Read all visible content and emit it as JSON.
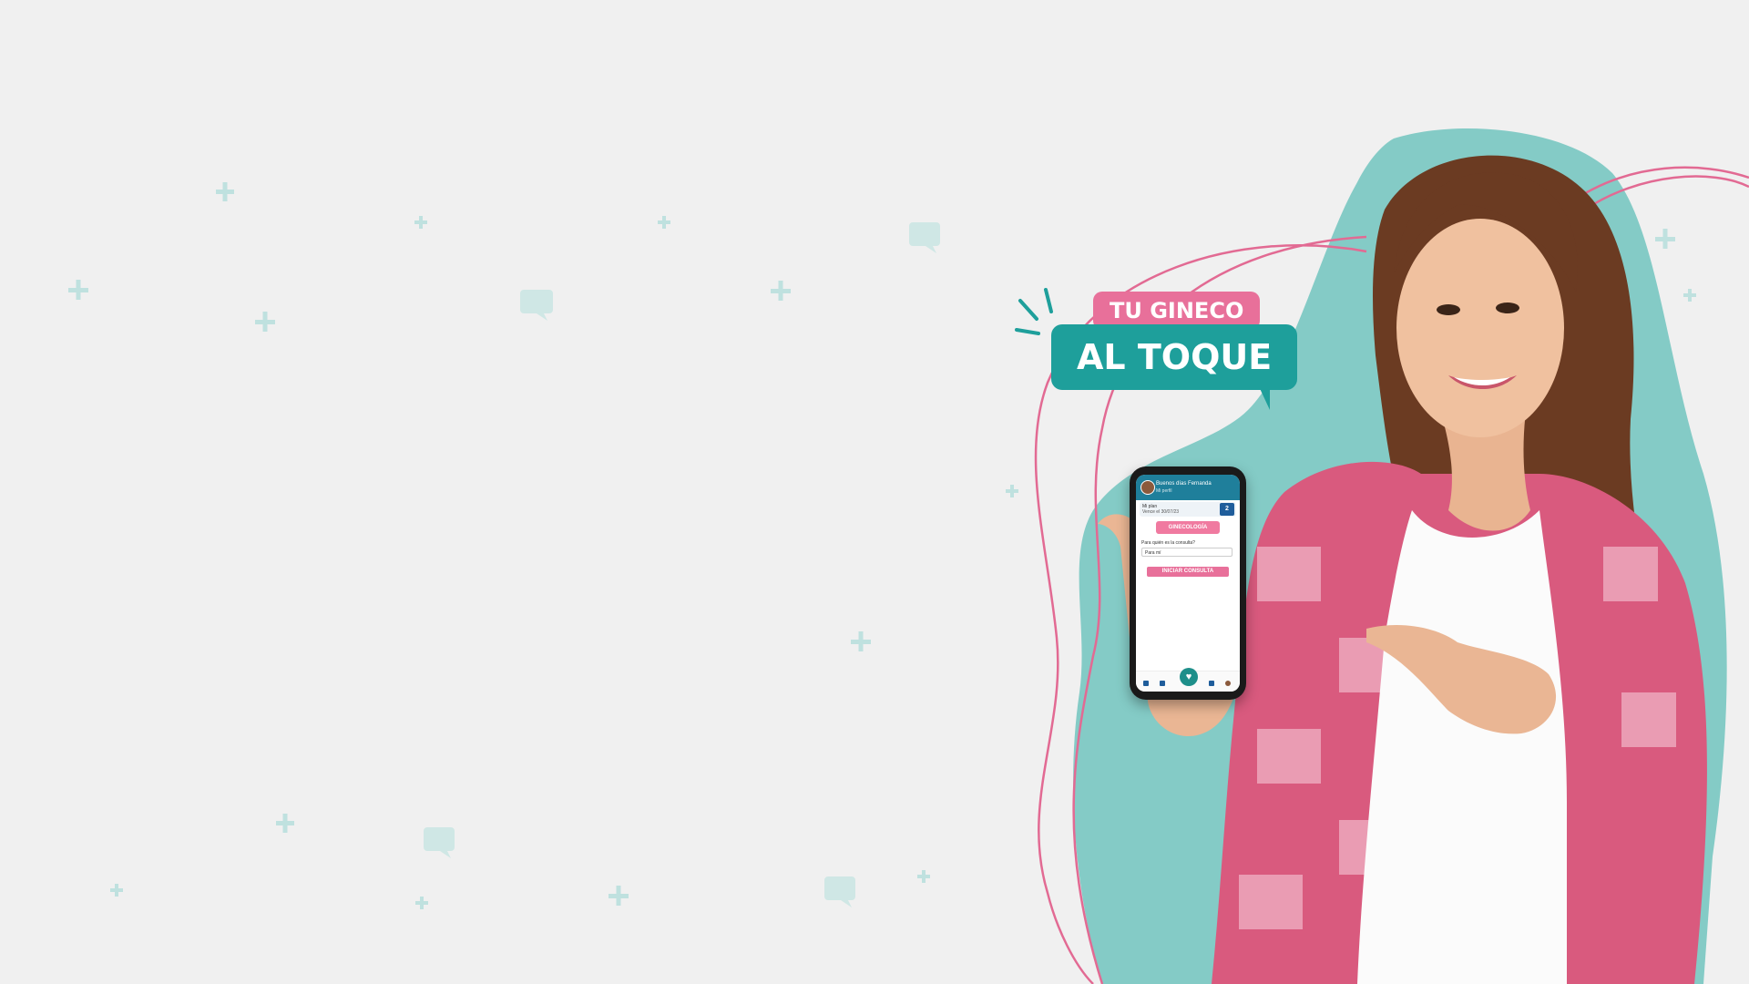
{
  "hero": {
    "badge_line1": "TU GINECO",
    "badge_line2": "AL TOQUE"
  },
  "phone": {
    "greeting": "Buenos días Fernanda",
    "subtitle": "Mi perfil",
    "card_title": "Mi plan",
    "card_subtitle": "Vence el 30/07/23",
    "card_count": "2",
    "specialty_label": "GINECOLOGÍA",
    "question_label": "Para quién es la consulta?",
    "select_value": "Para mí",
    "start_button": "INICIAR CONSULTA",
    "heart_glyph": "♥"
  },
  "colors": {
    "background": "#f0f0f0",
    "teal": "#1e9f9b",
    "teal_light": "#7cc7c3",
    "pink": "#e8709a",
    "navy": "#1f5d9b"
  },
  "icons": [
    "plus-icon",
    "chat-bubble-icon",
    "heart-icon",
    "home-icon"
  ]
}
